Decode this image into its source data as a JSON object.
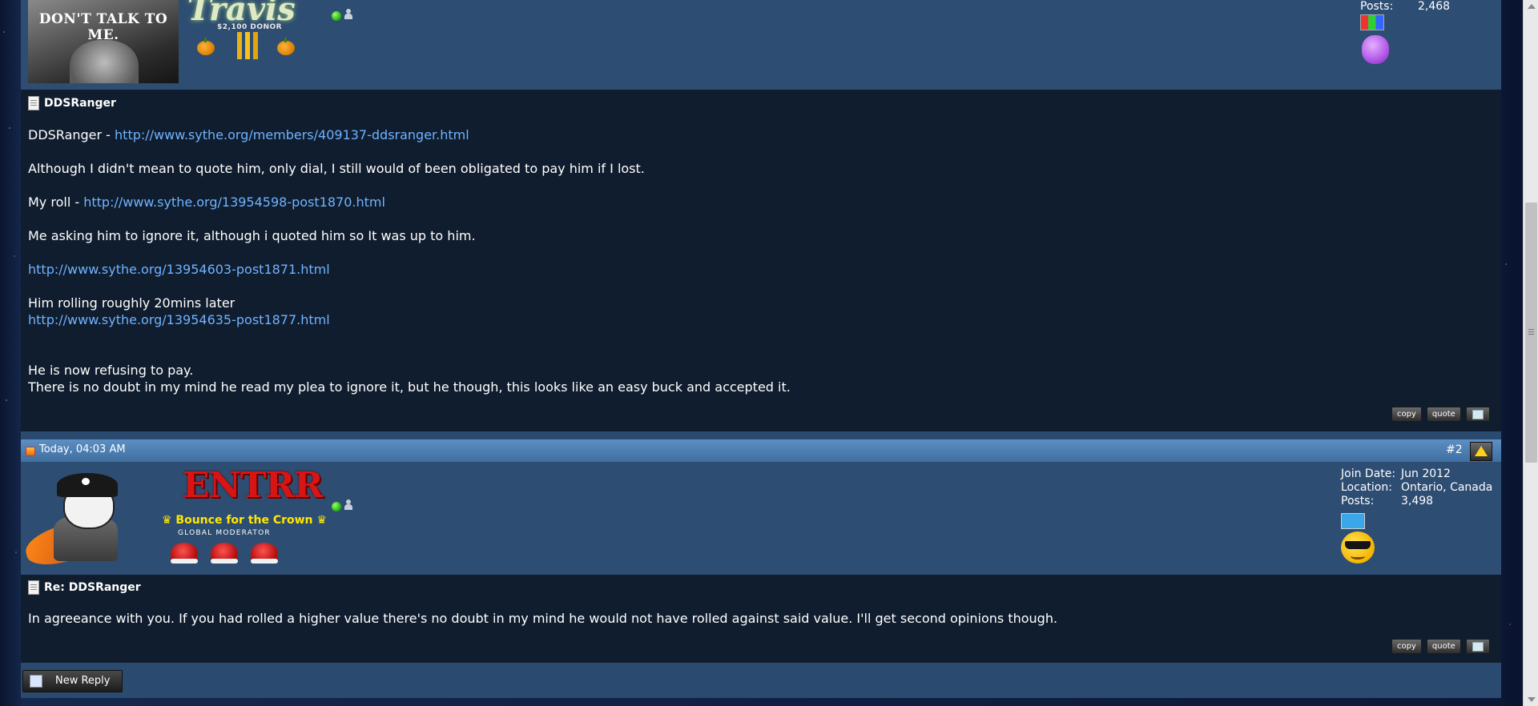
{
  "post1": {
    "header": {
      "avatar_caption": "DON'T TALK TO ME.",
      "username_art": "Travis",
      "donor_text": "$2,100 DONOR",
      "posts_label": "Posts:",
      "posts_value": "2,468"
    },
    "title": "DDSRanger",
    "lines": {
      "l1_prefix": "DDSRanger - ",
      "l1_link": "http://www.sythe.org/members/409137-ddsranger.html",
      "l2": "Although I didn't mean to quote him, only dial, I still would of been obligated to pay him if I lost.",
      "l3_prefix": "My roll - ",
      "l3_link": "http://www.sythe.org/13954598-post1870.html",
      "l4": "Me asking him to ignore it, although i quoted him so It was up to him.",
      "l5_link": "http://www.sythe.org/13954603-post1871.html",
      "l6": "Him rolling roughly 20mins later",
      "l7_link": "http://www.sythe.org/13954635-post1877.html",
      "l8": "He is now refusing to pay.",
      "l9": "There is no doubt in my mind he read my plea to ignore it, but he though, this looks like an easy buck and accepted it."
    },
    "buttons": {
      "copy": "copy",
      "quote": "quote"
    }
  },
  "post2": {
    "date": "Today, 04:03 AM",
    "post_number": "#2",
    "username_art": "ENTRR",
    "rank": "♛ Bounce for the Crown ♛",
    "usertitle": "GLOBAL MODERATOR",
    "join_label": "Join Date:",
    "join_value": "Jun 2012",
    "location_label": "Location:",
    "location_value": "Ontario, Canada",
    "posts_label": "Posts:",
    "posts_value": "3,498",
    "title": "Re: DDSRanger",
    "body": "In agreeance with you. If you had rolled a higher value there's no doubt in my mind he would not have rolled against said value. I'll get second opinions though.",
    "buttons": {
      "copy": "copy",
      "quote": "quote"
    }
  },
  "new_reply_label": "New Reply",
  "colors": {
    "link": "#6fb3ff",
    "post_body_bg": "#101d2e",
    "header_bg": "#2e4d72",
    "datebar": "#4f80b3",
    "rank_yellow": "#ffe800",
    "username_red": "#d71515"
  },
  "icons": [
    "document-icon",
    "online-status-icon",
    "person-icon",
    "warn-icon",
    "pencil-icon",
    "multiquote-icon"
  ]
}
